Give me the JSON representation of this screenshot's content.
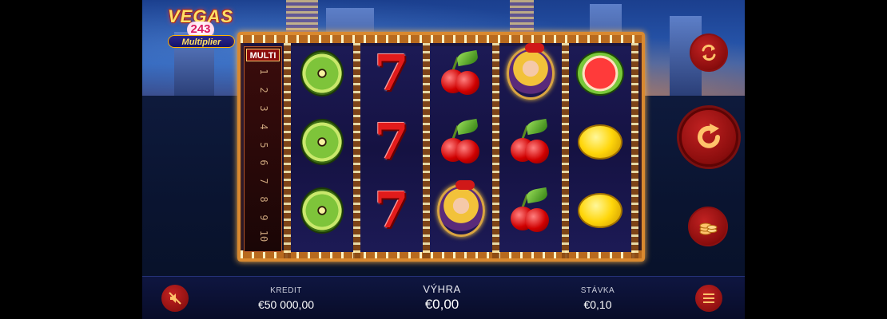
{
  "game": {
    "logo": {
      "word": "VEGAS",
      "number": "243",
      "subtitle": "Multiplier"
    },
    "multiplier_panel": {
      "label": "MULTI",
      "levels": [
        "1",
        "2",
        "3",
        "4",
        "5",
        "6",
        "7",
        "8",
        "9",
        "10"
      ]
    },
    "reels": [
      [
        "kiwi",
        "kiwi",
        "kiwi"
      ],
      [
        "seven",
        "seven",
        "seven"
      ],
      [
        "cherry",
        "cherry",
        "girl"
      ],
      [
        "girl",
        "cherry",
        "cherry"
      ],
      [
        "watermelon",
        "lemon",
        "lemon"
      ]
    ],
    "seven_glyph": "7",
    "icons": {
      "autoplay": "autoplay-arrows-icon",
      "spin": "spin-arrow-icon",
      "bet": "coin-stack-icon",
      "sound": "sound-muted-icon",
      "menu": "hamburger-menu-icon"
    }
  },
  "bottom_bar": {
    "credit_label": "KREDIT",
    "credit_value": "€50 000,00",
    "win_label": "VÝHRA",
    "win_value": "€0,00",
    "bet_label": "STÁVKA",
    "bet_value": "€0,10"
  },
  "colors": {
    "button_red": "#b01717",
    "frame_gold": "#d9892f",
    "text_white": "#ffffff"
  }
}
